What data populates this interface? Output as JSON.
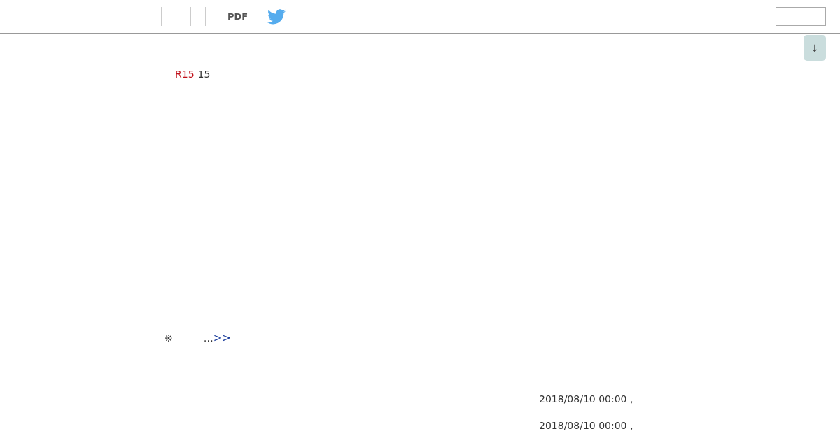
{
  "header": {
    "nav": [
      {
        "kind": "pdf",
        "label": "PDF"
      },
      {
        "kind": "twitter"
      }
    ]
  },
  "scroll_button": {
    "label": "↓"
  },
  "heading": {
    "tag": "R15",
    "text": "15"
  },
  "note": {
    "mark": "※",
    "text": "…",
    "link": ">>"
  },
  "dates": [
    "2018/08/10 00:00 ,",
    "2018/08/10 00:00 ,"
  ]
}
